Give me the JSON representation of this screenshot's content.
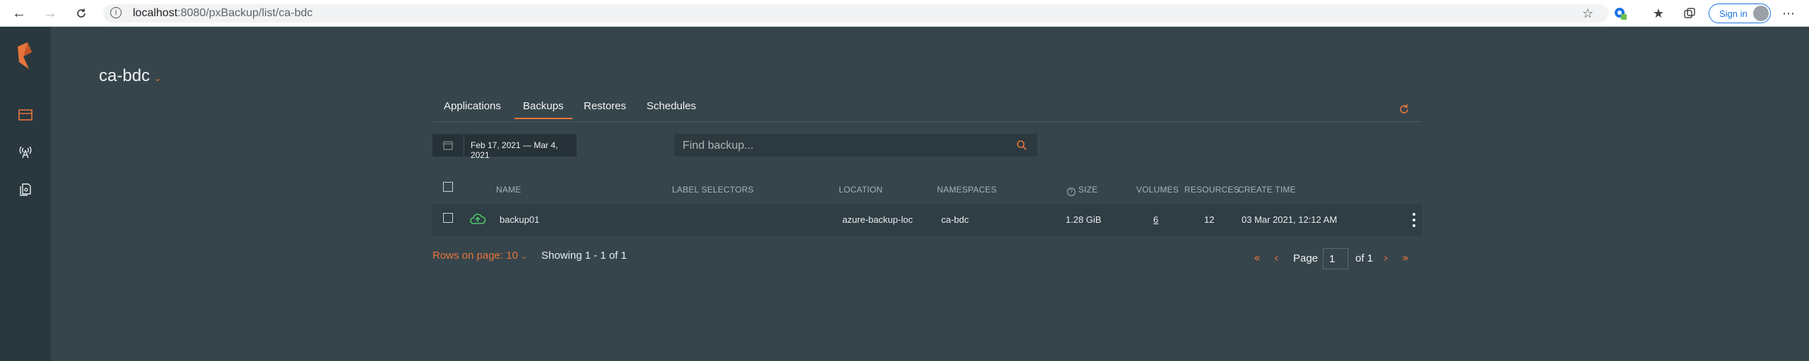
{
  "browser": {
    "url_host": "localhost",
    "url_rest": ":8080/pxBackup/list/ca-bdc",
    "signin_label": "Sign in"
  },
  "header": {
    "cluster_name": "ca-bdc"
  },
  "tabs": [
    {
      "label": "Applications"
    },
    {
      "label": "Backups"
    },
    {
      "label": "Restores"
    },
    {
      "label": "Schedules"
    }
  ],
  "filters": {
    "date_range": "Feb 17, 2021  —  Mar 4, 2021",
    "search_placeholder": "Find backup..."
  },
  "table": {
    "columns": [
      "NAME",
      "LABEL SELECTORS",
      "LOCATION",
      "NAMESPACES",
      "SIZE",
      "VOLUMES",
      "RESOURCES",
      "CREATE TIME"
    ],
    "rows": [
      {
        "name": "backup01",
        "label_selectors": "",
        "location": "azure-backup-loc",
        "namespaces": "ca-bdc",
        "size": "1.28 GiB",
        "volumes": "6",
        "resources": "12",
        "create_time": "03 Mar 2021, 12:12 AM"
      }
    ]
  },
  "pagination": {
    "rows_on_page": "Rows on page: 10",
    "showing": "Showing 1 - 1 of 1",
    "page_label": "Page",
    "page_value": "1",
    "of_label": "of 1"
  },
  "colors": {
    "accent": "#e8743b",
    "background": "#36454c",
    "sidebar": "#29383e"
  }
}
